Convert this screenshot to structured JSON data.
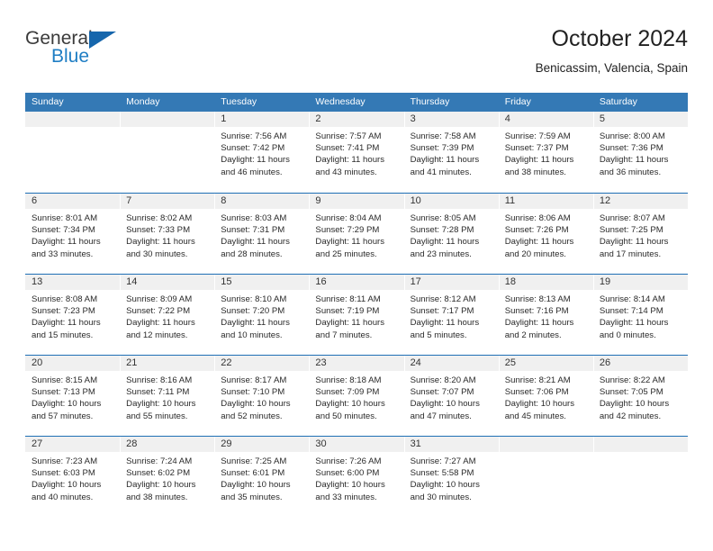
{
  "brand": {
    "name_top": "General",
    "name_bottom": "Blue",
    "triangle_icon": "triangle-icon",
    "color_top": "#3b3b3b",
    "color_bottom": "#1f7ec4",
    "triangle_color": "#1666ac"
  },
  "header": {
    "title": "October 2024",
    "subtitle": "Benicassim, Valencia, Spain"
  },
  "theme": {
    "header_blue": "#3479b5",
    "row_divider_blue": "#1f6fb5",
    "daynum_band": "#f0f0f0",
    "text": "#222222"
  },
  "calendar": {
    "weekday_headers": [
      "Sunday",
      "Monday",
      "Tuesday",
      "Wednesday",
      "Thursday",
      "Friday",
      "Saturday"
    ],
    "weeks": [
      [
        {
          "day": "",
          "lines": []
        },
        {
          "day": "",
          "lines": []
        },
        {
          "day": "1",
          "lines": [
            "Sunrise: 7:56 AM",
            "Sunset: 7:42 PM",
            "Daylight: 11 hours",
            "and 46 minutes."
          ]
        },
        {
          "day": "2",
          "lines": [
            "Sunrise: 7:57 AM",
            "Sunset: 7:41 PM",
            "Daylight: 11 hours",
            "and 43 minutes."
          ]
        },
        {
          "day": "3",
          "lines": [
            "Sunrise: 7:58 AM",
            "Sunset: 7:39 PM",
            "Daylight: 11 hours",
            "and 41 minutes."
          ]
        },
        {
          "day": "4",
          "lines": [
            "Sunrise: 7:59 AM",
            "Sunset: 7:37 PM",
            "Daylight: 11 hours",
            "and 38 minutes."
          ]
        },
        {
          "day": "5",
          "lines": [
            "Sunrise: 8:00 AM",
            "Sunset: 7:36 PM",
            "Daylight: 11 hours",
            "and 36 minutes."
          ]
        }
      ],
      [
        {
          "day": "6",
          "lines": [
            "Sunrise: 8:01 AM",
            "Sunset: 7:34 PM",
            "Daylight: 11 hours",
            "and 33 minutes."
          ]
        },
        {
          "day": "7",
          "lines": [
            "Sunrise: 8:02 AM",
            "Sunset: 7:33 PM",
            "Daylight: 11 hours",
            "and 30 minutes."
          ]
        },
        {
          "day": "8",
          "lines": [
            "Sunrise: 8:03 AM",
            "Sunset: 7:31 PM",
            "Daylight: 11 hours",
            "and 28 minutes."
          ]
        },
        {
          "day": "9",
          "lines": [
            "Sunrise: 8:04 AM",
            "Sunset: 7:29 PM",
            "Daylight: 11 hours",
            "and 25 minutes."
          ]
        },
        {
          "day": "10",
          "lines": [
            "Sunrise: 8:05 AM",
            "Sunset: 7:28 PM",
            "Daylight: 11 hours",
            "and 23 minutes."
          ]
        },
        {
          "day": "11",
          "lines": [
            "Sunrise: 8:06 AM",
            "Sunset: 7:26 PM",
            "Daylight: 11 hours",
            "and 20 minutes."
          ]
        },
        {
          "day": "12",
          "lines": [
            "Sunrise: 8:07 AM",
            "Sunset: 7:25 PM",
            "Daylight: 11 hours",
            "and 17 minutes."
          ]
        }
      ],
      [
        {
          "day": "13",
          "lines": [
            "Sunrise: 8:08 AM",
            "Sunset: 7:23 PM",
            "Daylight: 11 hours",
            "and 15 minutes."
          ]
        },
        {
          "day": "14",
          "lines": [
            "Sunrise: 8:09 AM",
            "Sunset: 7:22 PM",
            "Daylight: 11 hours",
            "and 12 minutes."
          ]
        },
        {
          "day": "15",
          "lines": [
            "Sunrise: 8:10 AM",
            "Sunset: 7:20 PM",
            "Daylight: 11 hours",
            "and 10 minutes."
          ]
        },
        {
          "day": "16",
          "lines": [
            "Sunrise: 8:11 AM",
            "Sunset: 7:19 PM",
            "Daylight: 11 hours",
            "and 7 minutes."
          ]
        },
        {
          "day": "17",
          "lines": [
            "Sunrise: 8:12 AM",
            "Sunset: 7:17 PM",
            "Daylight: 11 hours",
            "and 5 minutes."
          ]
        },
        {
          "day": "18",
          "lines": [
            "Sunrise: 8:13 AM",
            "Sunset: 7:16 PM",
            "Daylight: 11 hours",
            "and 2 minutes."
          ]
        },
        {
          "day": "19",
          "lines": [
            "Sunrise: 8:14 AM",
            "Sunset: 7:14 PM",
            "Daylight: 11 hours",
            "and 0 minutes."
          ]
        }
      ],
      [
        {
          "day": "20",
          "lines": [
            "Sunrise: 8:15 AM",
            "Sunset: 7:13 PM",
            "Daylight: 10 hours",
            "and 57 minutes."
          ]
        },
        {
          "day": "21",
          "lines": [
            "Sunrise: 8:16 AM",
            "Sunset: 7:11 PM",
            "Daylight: 10 hours",
            "and 55 minutes."
          ]
        },
        {
          "day": "22",
          "lines": [
            "Sunrise: 8:17 AM",
            "Sunset: 7:10 PM",
            "Daylight: 10 hours",
            "and 52 minutes."
          ]
        },
        {
          "day": "23",
          "lines": [
            "Sunrise: 8:18 AM",
            "Sunset: 7:09 PM",
            "Daylight: 10 hours",
            "and 50 minutes."
          ]
        },
        {
          "day": "24",
          "lines": [
            "Sunrise: 8:20 AM",
            "Sunset: 7:07 PM",
            "Daylight: 10 hours",
            "and 47 minutes."
          ]
        },
        {
          "day": "25",
          "lines": [
            "Sunrise: 8:21 AM",
            "Sunset: 7:06 PM",
            "Daylight: 10 hours",
            "and 45 minutes."
          ]
        },
        {
          "day": "26",
          "lines": [
            "Sunrise: 8:22 AM",
            "Sunset: 7:05 PM",
            "Daylight: 10 hours",
            "and 42 minutes."
          ]
        }
      ],
      [
        {
          "day": "27",
          "lines": [
            "Sunrise: 7:23 AM",
            "Sunset: 6:03 PM",
            "Daylight: 10 hours",
            "and 40 minutes."
          ]
        },
        {
          "day": "28",
          "lines": [
            "Sunrise: 7:24 AM",
            "Sunset: 6:02 PM",
            "Daylight: 10 hours",
            "and 38 minutes."
          ]
        },
        {
          "day": "29",
          "lines": [
            "Sunrise: 7:25 AM",
            "Sunset: 6:01 PM",
            "Daylight: 10 hours",
            "and 35 minutes."
          ]
        },
        {
          "day": "30",
          "lines": [
            "Sunrise: 7:26 AM",
            "Sunset: 6:00 PM",
            "Daylight: 10 hours",
            "and 33 minutes."
          ]
        },
        {
          "day": "31",
          "lines": [
            "Sunrise: 7:27 AM",
            "Sunset: 5:58 PM",
            "Daylight: 10 hours",
            "and 30 minutes."
          ]
        },
        {
          "day": "",
          "lines": []
        },
        {
          "day": "",
          "lines": []
        }
      ]
    ]
  }
}
